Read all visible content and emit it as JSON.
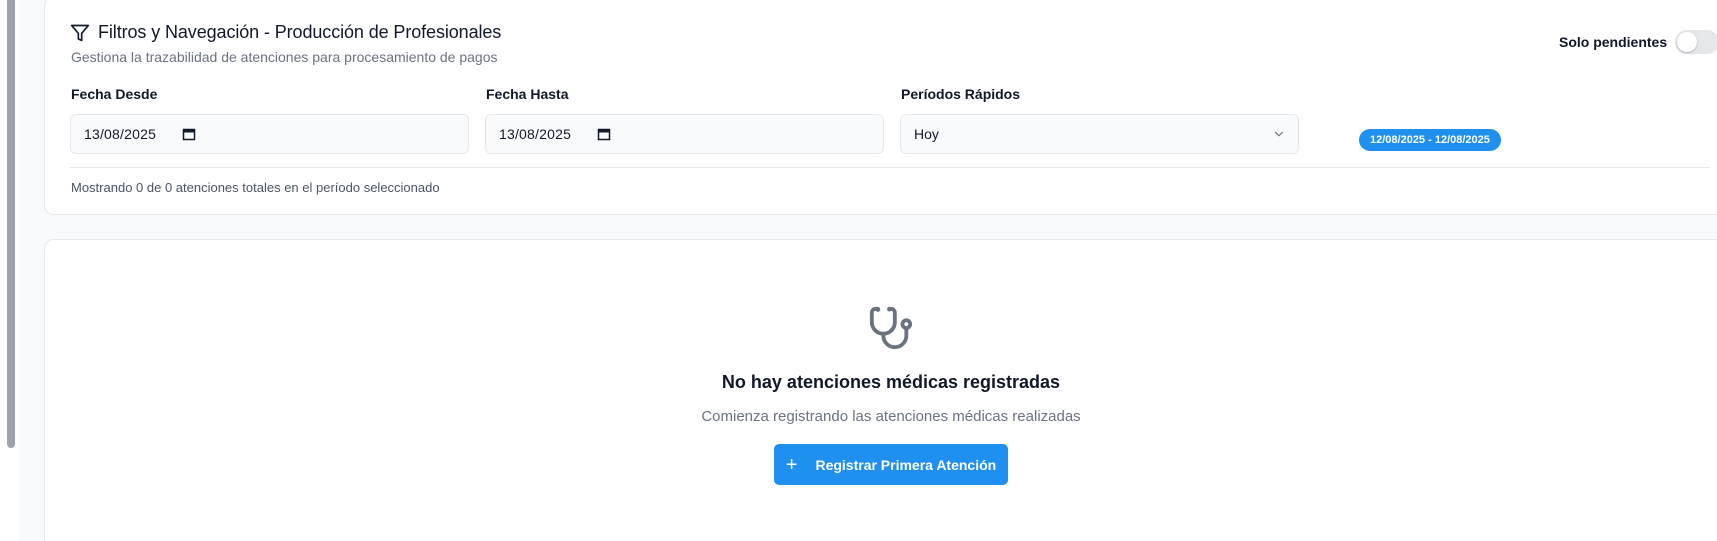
{
  "filters": {
    "title": "Filtros y Navegación - Producción de Profesionales",
    "subtitle": "Gestiona la trazabilidad de atenciones para procesamiento de pagos",
    "toggle_label": "Solo pendientes",
    "toggle_on": false,
    "date_from": {
      "label": "Fecha Desde",
      "value": "13/08/2025"
    },
    "date_to": {
      "label": "Fecha Hasta",
      "value": "13/08/2025"
    },
    "quick_periods": {
      "label": "Períodos Rápidos",
      "selected": "Hoy"
    },
    "range_badge": "12/08/2025 - 12/08/2025",
    "showing_text": "Mostrando 0 de 0 atenciones totales en el período seleccionado"
  },
  "empty_state": {
    "icon": "stethoscope-icon",
    "title": "No hay atenciones médicas registradas",
    "subtitle": "Comienza registrando las atenciones médicas realizadas",
    "button_label": "Registrar Primera Atención"
  },
  "colors": {
    "accent": "#1f8ff0",
    "muted_text": "#6b7280",
    "border": "#e5e7eb"
  }
}
